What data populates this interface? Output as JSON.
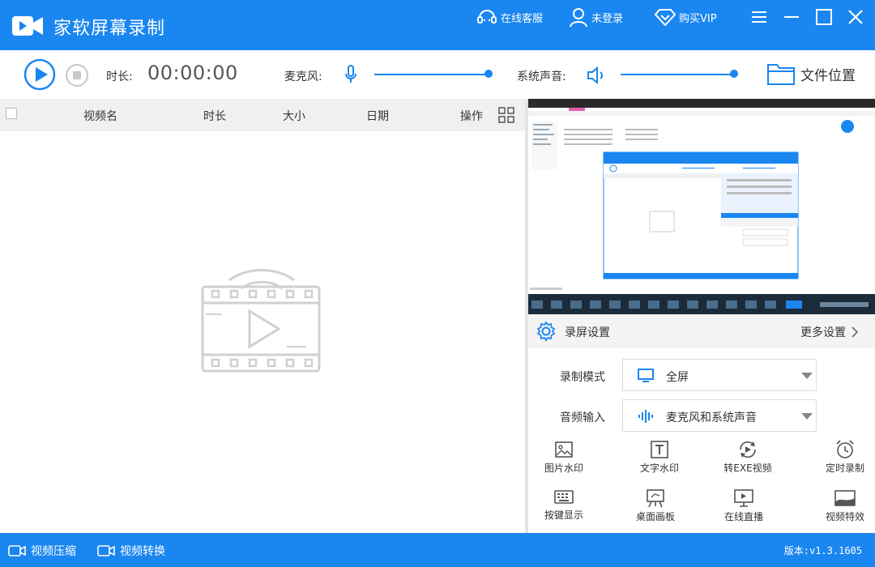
{
  "app": {
    "title": "家软屏幕录制"
  },
  "titlebar": {
    "online_service": "在线客服",
    "login": "未登录",
    "buy_vip": "购买VIP"
  },
  "toolbar": {
    "duration_label": "时长:",
    "duration_value": "00:00:00",
    "mic_label": "麦克风:",
    "system_sound_label": "系统声音:",
    "file_location": "文件位置",
    "mic_level": 1.0,
    "system_sound_level": 1.0
  },
  "video_list": {
    "columns": [
      "视频名",
      "时长",
      "大小",
      "日期",
      "操作"
    ],
    "rows": []
  },
  "settings": {
    "title": "录屏设置",
    "more": "更多设置",
    "record_mode_label": "录制模式",
    "record_mode_value": "全屏",
    "audio_input_label": "音频输入",
    "audio_input_value": "麦克风和系统声音"
  },
  "tools": [
    {
      "label": "图片水印",
      "icon": "image-icon"
    },
    {
      "label": "文字水印",
      "icon": "text-icon"
    },
    {
      "label": "转EXE视频",
      "icon": "convert-icon"
    },
    {
      "label": "定时录制",
      "icon": "alarm-icon"
    },
    {
      "label": "按键显示",
      "icon": "keyboard-icon"
    },
    {
      "label": "桌面画板",
      "icon": "easel-icon"
    },
    {
      "label": "在线直播",
      "icon": "live-icon"
    },
    {
      "label": "视频特效",
      "icon": "effects-icon"
    }
  ],
  "statusbar": {
    "compress": "视频压缩",
    "convert": "视频转换",
    "version": "版本:v1.3.1605"
  },
  "colors": {
    "accent": "#1a86f0",
    "header_bg": "#f0f0f0",
    "icon_gray": "#aaaaaa"
  }
}
